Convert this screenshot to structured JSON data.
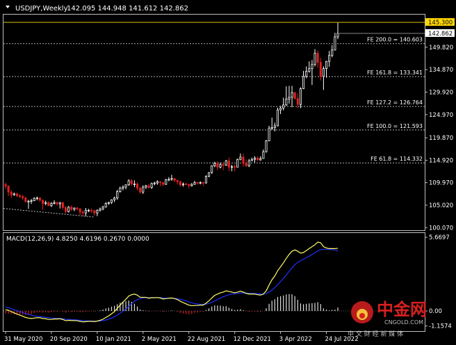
{
  "header": {
    "symbol": "USDJPY,Weekly",
    "ohlc": "142.095 144.948 141.612 142.862"
  },
  "colors": {
    "background": "#000000",
    "axis": "#c0c0c0",
    "text": "#ffffff",
    "bull": "#ffffff",
    "bear": "#e02020",
    "fibo": "#b0b0b0",
    "macd_line": "#ffff66",
    "signal_line": "#2030ff",
    "hist": "#e0e0e0",
    "hist_neg": "#e02020",
    "price_tag_bg": "#ffffff",
    "high_tag_bg": "#ffd700",
    "watermark": "#d82020"
  },
  "price_axis": {
    "ticks": [
      "149.820",
      "134.870",
      "129.920",
      "124.970",
      "119.870",
      "114.920",
      "109.970",
      "105.020",
      "100.070"
    ],
    "tick_values": [
      139.82,
      134.87,
      129.92,
      124.97,
      119.87,
      114.92,
      109.97,
      105.02,
      100.07
    ],
    "current": "142.862",
    "current_value": 142.862,
    "high_tag": "145.300",
    "high_value": 145.3,
    "range": [
      99.5,
      147.0
    ]
  },
  "fibo_levels": [
    {
      "label": "FE 200.0 = 140.603",
      "value": 140.603
    },
    {
      "label": "FE 161.8 = 133.341",
      "value": 133.341
    },
    {
      "label": "FE 127.2 = 126.764",
      "value": 126.764
    },
    {
      "label": "FE 100.0 = 121.593",
      "value": 121.593
    },
    {
      "label": "FE 61.8 = 114.332",
      "value": 114.332
    }
  ],
  "macd": {
    "label": "MACD(12,26,9) 4.8250 4.6196 0.2670 0.0000",
    "ticks": [
      "5.6697",
      "0.00",
      "-1.1574"
    ],
    "tick_values": [
      5.6697,
      0.0,
      -1.1574
    ],
    "range": [
      -1.55,
      6.0
    ]
  },
  "time_axis": {
    "labels": [
      "31 May 2020",
      "20 Sep 2020",
      "10 Jan 2021",
      "2 May 2021",
      "22 Aug 2021",
      "12 Dec 2021",
      "3 Apr 2022",
      "24 Jul 2022"
    ],
    "label_bar_index": [
      0,
      16,
      32,
      48,
      64,
      80,
      96,
      112
    ]
  },
  "watermark": {
    "brand": "中金网",
    "site": "CNGOLD.COM",
    "tagline": "中 文 财 经 新 媒 体"
  },
  "chart_data": {
    "type": "candlestick",
    "title": "USDJPY,Weekly",
    "xlabel": "",
    "ylabel": "",
    "interval": "weekly",
    "start_bar": "31 May 2020",
    "ylim": [
      99.5,
      147.0
    ],
    "series": [
      {
        "name": "USDJPY",
        "open": [
          109.6,
          109.2,
          107.9,
          107.3,
          107.5,
          107.1,
          106.9,
          106.6,
          105.8,
          105.9,
          106.0,
          106.5,
          106.6,
          106.1,
          105.4,
          105.6,
          104.9,
          105.4,
          105.6,
          105.3,
          105.6,
          104.5,
          103.6,
          104.6,
          104.1,
          104.4,
          104.2,
          103.5,
          103.3,
          103.9,
          103.9,
          103.8,
          103.3,
          103.9,
          104.2,
          104.6,
          105.4,
          105.6,
          106.2,
          106.6,
          108.0,
          108.8,
          109.0,
          109.5,
          110.4,
          109.7,
          109.7,
          108.8,
          107.9,
          109.0,
          109.3,
          108.9,
          109.8,
          109.9,
          110.2,
          110.0,
          109.6,
          110.6,
          110.7,
          110.9,
          110.5,
          110.2,
          109.5,
          109.7,
          109.6,
          109.3,
          109.6,
          110.0,
          109.9,
          110.0,
          109.9,
          111.4,
          112.2,
          113.7,
          114.2,
          113.4,
          114.0,
          113.8,
          114.8,
          113.4,
          113.5,
          113.4,
          115.1,
          115.6,
          114.2,
          113.7,
          114.8,
          115.1,
          115.4,
          115.0,
          115.3,
          116.8,
          119.2,
          122.0,
          122.1,
          122.5,
          126.0,
          126.4,
          127.1,
          128.4,
          128.8,
          129.8,
          128.5,
          127.2,
          130.7,
          133.4,
          134.5,
          135.1,
          136.0,
          138.5,
          136.5,
          133.4,
          135.1,
          136.7,
          138.0,
          139.2,
          142.1
        ],
        "high": [
          110.0,
          109.4,
          108.3,
          107.8,
          107.8,
          107.5,
          107.3,
          106.9,
          106.2,
          106.4,
          106.8,
          106.9,
          106.8,
          106.3,
          106.0,
          105.8,
          105.7,
          106.1,
          105.8,
          105.7,
          105.7,
          104.8,
          104.8,
          105.0,
          104.5,
          104.6,
          104.4,
          103.9,
          104.4,
          104.2,
          104.3,
          104.0,
          104.1,
          104.5,
          104.9,
          105.7,
          105.8,
          106.3,
          106.9,
          108.4,
          109.1,
          109.4,
          109.6,
          110.7,
          110.8,
          110.5,
          110.0,
          109.1,
          109.4,
          109.5,
          109.7,
          110.0,
          110.2,
          110.5,
          110.3,
          110.1,
          110.8,
          111.2,
          111.7,
          111.0,
          110.6,
          110.4,
          110.0,
          110.0,
          109.8,
          109.9,
          110.4,
          110.2,
          110.3,
          110.2,
          111.6,
          112.3,
          113.8,
          114.6,
          114.7,
          114.4,
          114.5,
          115.0,
          115.5,
          113.9,
          114.0,
          115.3,
          116.4,
          116.4,
          115.1,
          115.2,
          115.5,
          115.8,
          115.8,
          115.8,
          117.3,
          119.4,
          122.5,
          124.3,
          123.2,
          126.5,
          126.9,
          128.7,
          131.2,
          131.3,
          131.3,
          130.0,
          129.6,
          131.0,
          134.6,
          135.6,
          136.7,
          137.0,
          139.4,
          139.1,
          137.5,
          135.6,
          136.8,
          139.0,
          140.3,
          143.0,
          145.3
        ],
        "low": [
          108.6,
          107.0,
          106.6,
          107.1,
          106.8,
          106.6,
          106.1,
          105.6,
          104.2,
          105.3,
          105.9,
          106.1,
          105.8,
          104.0,
          105.0,
          104.9,
          104.6,
          105.2,
          104.9,
          104.3,
          104.0,
          103.2,
          103.4,
          103.7,
          103.7,
          103.9,
          102.8,
          102.6,
          102.6,
          103.5,
          103.3,
          102.7,
          102.6,
          103.6,
          103.9,
          104.5,
          105.1,
          105.3,
          105.7,
          106.2,
          107.8,
          108.3,
          108.5,
          109.3,
          109.3,
          109.0,
          108.3,
          107.5,
          107.5,
          108.6,
          108.7,
          108.6,
          109.4,
          109.5,
          109.2,
          109.2,
          109.5,
          110.3,
          110.4,
          110.1,
          109.6,
          109.1,
          109.1,
          109.4,
          108.7,
          109.1,
          109.5,
          109.5,
          109.6,
          109.2,
          109.8,
          111.2,
          111.9,
          113.4,
          112.7,
          113.1,
          112.7,
          113.7,
          112.5,
          112.5,
          112.5,
          113.4,
          114.9,
          113.5,
          113.4,
          113.4,
          114.8,
          114.4,
          114.8,
          114.8,
          115.3,
          116.6,
          119.1,
          121.6,
          121.3,
          122.4,
          125.1,
          125.9,
          126.9,
          127.4,
          126.6,
          128.3,
          126.4,
          126.4,
          130.6,
          133.0,
          134.2,
          131.5,
          135.6,
          135.3,
          132.5,
          130.4,
          133.1,
          135.5,
          137.6,
          139.1,
          141.6
        ],
        "close": [
          109.2,
          107.9,
          107.3,
          107.5,
          107.1,
          106.9,
          106.6,
          105.8,
          105.9,
          106.0,
          106.5,
          106.6,
          106.1,
          105.4,
          105.6,
          104.9,
          105.4,
          105.6,
          105.3,
          105.6,
          104.5,
          103.6,
          104.6,
          104.1,
          104.4,
          104.2,
          103.5,
          103.3,
          103.9,
          103.9,
          103.8,
          103.3,
          103.9,
          104.2,
          104.6,
          105.4,
          105.6,
          106.2,
          106.6,
          108.0,
          108.8,
          109.0,
          109.5,
          110.4,
          109.7,
          109.7,
          108.8,
          107.9,
          109.0,
          109.3,
          108.9,
          109.8,
          109.9,
          110.2,
          110.0,
          109.6,
          110.6,
          110.7,
          110.9,
          110.5,
          110.2,
          109.5,
          109.7,
          109.6,
          109.3,
          109.6,
          110.0,
          109.9,
          110.0,
          109.9,
          111.4,
          112.2,
          113.7,
          114.2,
          113.4,
          114.0,
          113.8,
          114.8,
          113.4,
          113.5,
          113.4,
          115.1,
          115.6,
          114.2,
          113.7,
          114.8,
          115.1,
          115.4,
          115.0,
          115.3,
          116.8,
          119.2,
          122.0,
          122.1,
          122.5,
          126.0,
          126.4,
          127.1,
          128.4,
          128.8,
          129.8,
          128.5,
          127.2,
          130.7,
          133.4,
          134.5,
          135.1,
          136.0,
          138.5,
          136.5,
          133.4,
          135.1,
          136.7,
          138.0,
          139.2,
          142.1,
          142.862
        ]
      }
    ],
    "indicator": {
      "name": "MACD(12,26,9)",
      "macd": [
        0.1,
        0.05,
        -0.05,
        -0.15,
        -0.25,
        -0.32,
        -0.4,
        -0.5,
        -0.55,
        -0.58,
        -0.55,
        -0.52,
        -0.52,
        -0.58,
        -0.6,
        -0.65,
        -0.65,
        -0.62,
        -0.62,
        -0.6,
        -0.66,
        -0.75,
        -0.72,
        -0.74,
        -0.74,
        -0.75,
        -0.8,
        -0.84,
        -0.82,
        -0.8,
        -0.8,
        -0.82,
        -0.78,
        -0.72,
        -0.64,
        -0.5,
        -0.38,
        -0.22,
        -0.05,
        0.2,
        0.45,
        0.68,
        0.9,
        1.15,
        1.25,
        1.3,
        1.22,
        1.05,
        1.05,
        1.05,
        0.98,
        1.02,
        1.02,
        1.03,
        1.0,
        0.92,
        0.95,
        0.98,
        1.0,
        0.95,
        0.88,
        0.75,
        0.65,
        0.55,
        0.45,
        0.4,
        0.42,
        0.42,
        0.45,
        0.45,
        0.6,
        0.78,
        1.0,
        1.2,
        1.3,
        1.4,
        1.45,
        1.55,
        1.5,
        1.45,
        1.4,
        1.45,
        1.52,
        1.45,
        1.35,
        1.3,
        1.3,
        1.3,
        1.25,
        1.22,
        1.3,
        1.55,
        2.0,
        2.4,
        2.7,
        3.1,
        3.4,
        3.7,
        4.05,
        4.35,
        4.6,
        4.7,
        4.6,
        4.45,
        4.5,
        4.65,
        4.8,
        4.95,
        5.1,
        5.3,
        5.25,
        4.95,
        4.85,
        4.8,
        4.8,
        4.8,
        4.825
      ],
      "signal": [
        0.3,
        0.25,
        0.18,
        0.1,
        0.02,
        -0.05,
        -0.12,
        -0.2,
        -0.27,
        -0.33,
        -0.38,
        -0.41,
        -0.43,
        -0.46,
        -0.49,
        -0.52,
        -0.55,
        -0.56,
        -0.57,
        -0.58,
        -0.6,
        -0.63,
        -0.65,
        -0.67,
        -0.68,
        -0.7,
        -0.72,
        -0.74,
        -0.76,
        -0.77,
        -0.77,
        -0.78,
        -0.78,
        -0.77,
        -0.74,
        -0.7,
        -0.63,
        -0.55,
        -0.45,
        -0.32,
        -0.18,
        -0.02,
        0.15,
        0.35,
        0.55,
        0.75,
        0.88,
        0.95,
        1.0,
        1.02,
        1.03,
        1.03,
        1.03,
        1.03,
        1.02,
        1.0,
        0.98,
        0.97,
        0.97,
        0.96,
        0.94,
        0.9,
        0.85,
        0.78,
        0.7,
        0.62,
        0.57,
        0.53,
        0.51,
        0.5,
        0.52,
        0.58,
        0.66,
        0.77,
        0.88,
        0.99,
        1.09,
        1.18,
        1.25,
        1.3,
        1.32,
        1.35,
        1.38,
        1.39,
        1.38,
        1.36,
        1.35,
        1.34,
        1.32,
        1.3,
        1.3,
        1.34,
        1.45,
        1.61,
        1.8,
        2.02,
        2.26,
        2.51,
        2.78,
        3.05,
        3.32,
        3.56,
        3.74,
        3.87,
        3.98,
        4.1,
        4.22,
        4.35,
        4.48,
        4.62,
        4.72,
        4.75,
        4.75,
        4.74,
        4.72,
        4.7,
        4.6196
      ],
      "histogram": [
        -0.2,
        -0.2,
        -0.23,
        -0.25,
        -0.27,
        -0.27,
        -0.28,
        -0.3,
        -0.28,
        -0.25,
        -0.17,
        -0.11,
        -0.09,
        -0.12,
        -0.11,
        -0.13,
        -0.1,
        -0.06,
        -0.05,
        -0.02,
        -0.06,
        -0.12,
        -0.07,
        -0.07,
        -0.06,
        -0.05,
        -0.08,
        -0.1,
        -0.06,
        -0.03,
        -0.03,
        -0.04,
        0.0,
        0.05,
        0.1,
        0.2,
        0.25,
        0.33,
        0.4,
        0.52,
        0.63,
        0.7,
        0.75,
        0.8,
        0.7,
        0.55,
        0.34,
        0.1,
        0.05,
        0.03,
        -0.05,
        -0.01,
        -0.01,
        0.0,
        -0.02,
        -0.08,
        -0.03,
        0.01,
        0.03,
        -0.01,
        -0.06,
        -0.15,
        -0.2,
        -0.23,
        -0.25,
        -0.22,
        -0.15,
        -0.11,
        -0.06,
        -0.05,
        0.08,
        0.2,
        0.34,
        0.43,
        0.42,
        0.41,
        0.36,
        0.37,
        0.25,
        0.15,
        0.08,
        0.1,
        0.14,
        0.06,
        -0.03,
        -0.06,
        -0.05,
        -0.04,
        -0.07,
        -0.08,
        0.0,
        0.21,
        0.55,
        0.79,
        0.9,
        1.08,
        1.14,
        1.19,
        1.27,
        1.3,
        1.28,
        1.14,
        0.86,
        0.58,
        0.52,
        0.55,
        0.58,
        0.6,
        0.62,
        0.68,
        0.53,
        0.2,
        0.1,
        0.06,
        0.08,
        0.1,
        0.267
      ],
      "ylim": [
        -1.55,
        6.0
      ]
    }
  }
}
